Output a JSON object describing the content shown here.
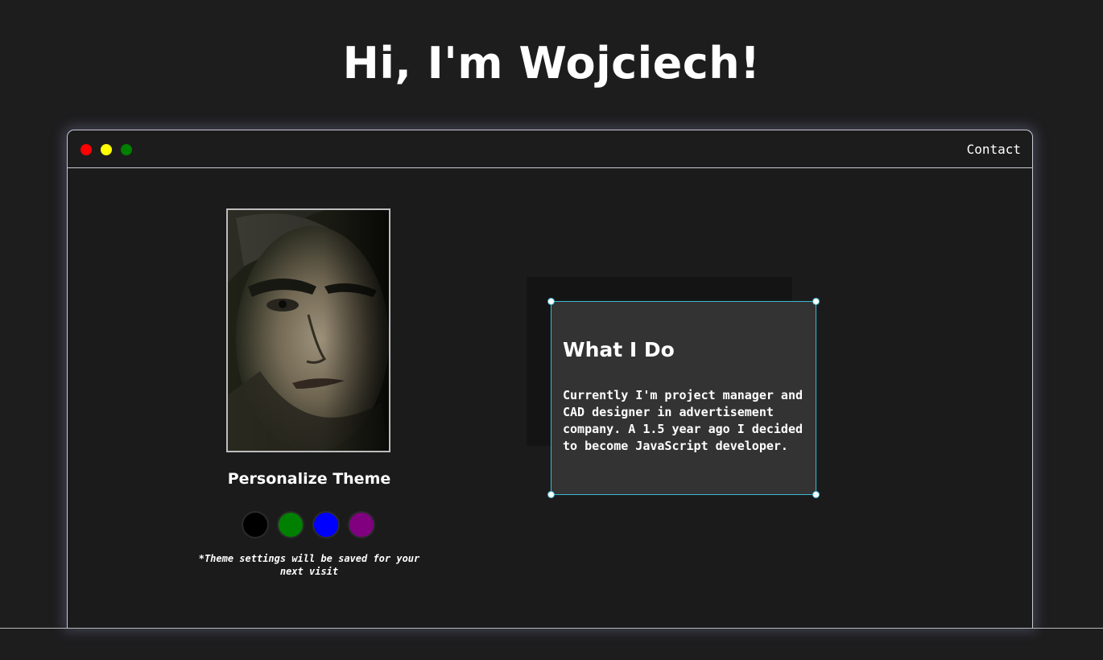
{
  "hero": {
    "title": "Hi, I'm Wojciech!"
  },
  "window": {
    "controls": [
      "close-dot",
      "minimize-dot",
      "maximize-dot"
    ],
    "nav": {
      "contact_label": "Contact"
    }
  },
  "profile": {
    "photo_alt": "portrait photo"
  },
  "theme": {
    "title": "Personalize Theme",
    "swatches": [
      {
        "name": "black",
        "color": "#000000"
      },
      {
        "name": "green",
        "color": "#008000"
      },
      {
        "name": "blue",
        "color": "#0000ff"
      },
      {
        "name": "purple",
        "color": "#800080"
      }
    ],
    "note": "*Theme settings will be saved for your next visit"
  },
  "about": {
    "title": "What I Do",
    "text": "Currently I'm project manager and CAD designer in advertisement company. A 1.5 year ago I decided to become JavaScript developer."
  },
  "colors": {
    "background": "#1d1d1e",
    "accent": "#3cb8cf",
    "card": "#333333"
  }
}
